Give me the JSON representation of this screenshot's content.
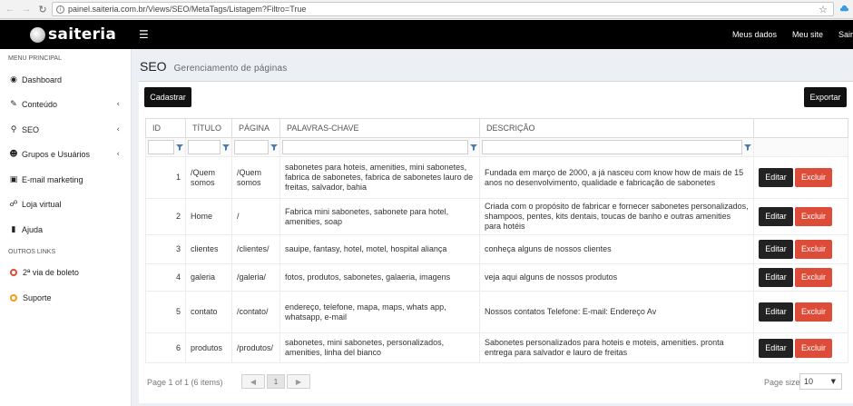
{
  "browser": {
    "url": "painel.saiteria.com.br/Views/SEO/MetaTags/Listagem?Filtro=True"
  },
  "header": {
    "brand": "saiteria",
    "links": [
      "Meus dados",
      "Meu site",
      "Sair"
    ]
  },
  "sidebar": {
    "main_title": "MENU PRINCIPAL",
    "items": [
      {
        "label": "Dashboard",
        "icon": "dashboard-icon",
        "chevron": false
      },
      {
        "label": "Conteúdo",
        "icon": "edit-icon",
        "chevron": true
      },
      {
        "label": "SEO",
        "icon": "search-icon",
        "chevron": true
      },
      {
        "label": "Grupos e Usuários",
        "icon": "users-icon",
        "chevron": true
      },
      {
        "label": "E-mail marketing",
        "icon": "inbox-icon",
        "chevron": false
      },
      {
        "label": "Loja virtual",
        "icon": "cart-icon",
        "chevron": false
      },
      {
        "label": "Ajuda",
        "icon": "book-icon",
        "chevron": false
      }
    ],
    "other_title": "OUTROS LINKS",
    "other_items": [
      {
        "label": "2ª via de boleto",
        "color": "#dd4b39"
      },
      {
        "label": "Suporte",
        "color": "#f39c12"
      }
    ]
  },
  "page": {
    "title": "SEO",
    "subtitle": "Gerenciamento de páginas",
    "create_label": "Cadastrar",
    "export_label": "Exportar"
  },
  "table": {
    "columns": [
      "ID",
      "TÍTULO",
      "PÁGINA",
      "PALAVRAS-CHAVE",
      "DESCRIÇÃO"
    ],
    "rows": [
      {
        "id": "1",
        "titulo": "/Quem somos",
        "pagina": "/Quem somos",
        "palavras": "sabonetes para hoteis, amenities, mini sabonetes, fabrica de sabonetes, fabrica de sabonetes lauro de freitas, salvador, bahia",
        "descricao": "Fundada em março de 2000, a                    já nasceu com know how de mais de 15 anos no desenvolvimento, qualidade e fabricação de sabonetes"
      },
      {
        "id": "2",
        "titulo": "Home",
        "pagina": "/",
        "palavras": "Fabrica mini sabonetes, sabonete para hotel, amenities, soap",
        "descricao": "Criada com o propósito de fabricar e fornecer sabonetes personalizados, shampoos, pentes, kits dentais, toucas de banho e outras amenities para hotéis"
      },
      {
        "id": "3",
        "titulo": "clientes",
        "pagina": "/clientes/",
        "palavras": "sauipe, fantasy, hotel, motel, hospital aliança",
        "descricao": "conheça alguns de nossos clientes"
      },
      {
        "id": "4",
        "titulo": "galeria",
        "pagina": "/galeria/",
        "palavras": "fotos, produtos, sabonetes, galaeria, imagens",
        "descricao": "veja aqui alguns de nossos produtos"
      },
      {
        "id": "5",
        "titulo": "contato",
        "pagina": "/contato/",
        "palavras": "endereço, telefone, mapa, maps, whats app, whatsapp, e-mail",
        "descricao": "Nossos contatos Telefone:                              E-mail:                              Endereço Av"
      },
      {
        "id": "6",
        "titulo": "produtos",
        "pagina": "/produtos/",
        "palavras": "sabonetes, mini sabonetes, personalizados, amenities, linha del bianco",
        "descricao": "Sabonetes personalizados para hoteis e moteis, amenities. pronta entrega para salvador e lauro de freitas"
      }
    ],
    "edit_label": "Editar",
    "delete_label": "Excluir"
  },
  "pager": {
    "summary": "Page 1 of 1 (6 items)",
    "current_page": "1",
    "page_size_label": "Page size:",
    "page_size_value": "10"
  },
  "colors": {
    "danger": "#dd4b39",
    "dark": "#111111",
    "background": "#ecf0f5"
  }
}
